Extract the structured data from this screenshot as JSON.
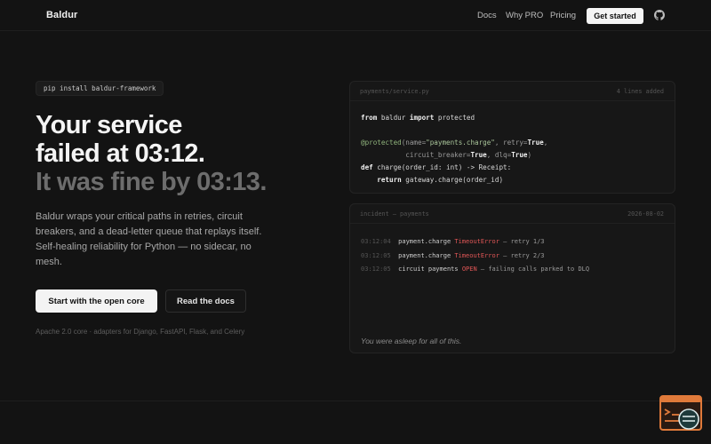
{
  "nav": {
    "logo": "Baldur",
    "links": [
      {
        "label": "Docs"
      },
      {
        "label": "Why PRO"
      },
      {
        "label": "Pricing"
      }
    ],
    "cta": "Get started",
    "github_icon": "github-icon"
  },
  "hero": {
    "pip": "pip install baldur-framework",
    "headline_1": "Your service",
    "headline_2": "failed at 03:12.",
    "headline_3": "It was fine by 03:13.",
    "description": "Baldur wraps your critical paths in retries, circuit breakers, and a dead-letter queue that replays itself. Self-healing reliability for Python — no sidecar, no mesh.",
    "primary_button": "Start with the open core",
    "secondary_button": "Read the docs",
    "note": "Apache 2.0 core · adapters for Django, FastAPI, Flask, and Celery"
  },
  "code_panel": {
    "filename": "payments/service.py",
    "status": "4 lines added",
    "lines": {
      "l1_a": "from",
      "l1_b": " baldur ",
      "l1_c": "import",
      "l1_d": " protected",
      "l3_a": "@protected",
      "l3_b": "(name=",
      "l3_c": "\"payments.charge\"",
      "l3_d": ", retry=",
      "l3_e": "True",
      "l3_f": ",",
      "l4_a": "           circuit_breaker=",
      "l4_b": "True",
      "l4_c": ", dlq=",
      "l4_d": "True",
      "l4_e": ")",
      "l5_a": "def",
      "l5_b": " charge(order_id: int) -> Receipt:",
      "l6_a": "    return",
      "l6_b": " gateway.charge(order_id)"
    }
  },
  "incident_panel": {
    "title": "incident — payments",
    "date": "2026-08-02",
    "events": [
      {
        "time": "03:12:04",
        "pre": "payment.charge ",
        "red": "TimeoutError",
        "post": " — retry 1/3"
      },
      {
        "time": "03:12:05",
        "pre": "payment.charge ",
        "red": "TimeoutError",
        "post": " — retry 2/3"
      },
      {
        "time": "03:12:05",
        "pre": "circuit payments ",
        "red": "OPEN",
        "post": " — failing calls parked to DLQ"
      }
    ],
    "footer": "You were asleep for all of this."
  },
  "colors": {
    "background": "#131313",
    "accent_red": "#e05656",
    "decorator_green": "#8fb37c",
    "widget_orange": "#e07a3a"
  },
  "widget": {
    "icon": "feedback-widget-icon"
  }
}
